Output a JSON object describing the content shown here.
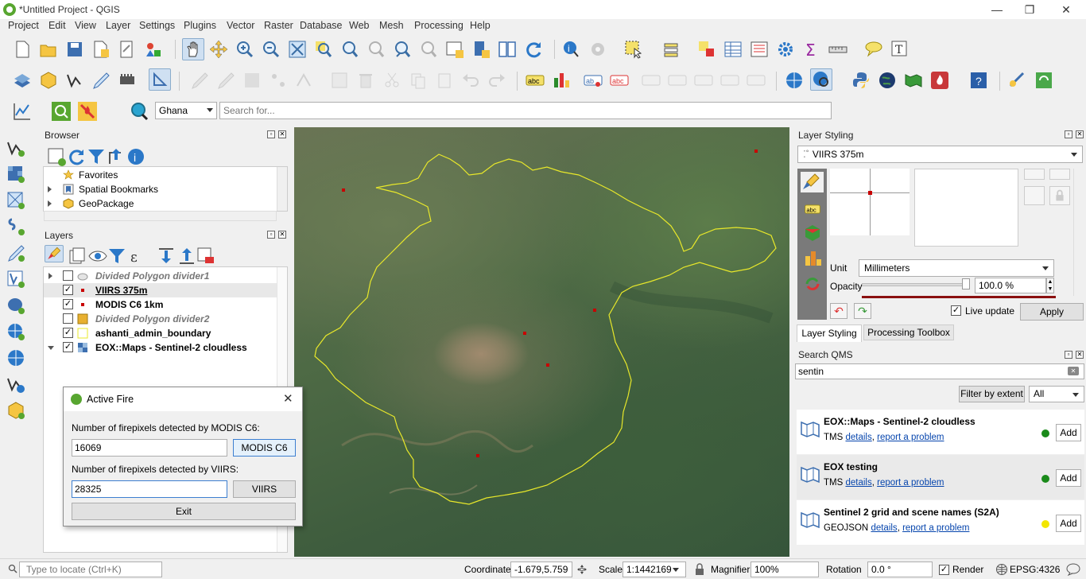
{
  "window": {
    "title": "*Untitled Project - QGIS",
    "minimize": "—",
    "restore": "❐",
    "close": "✕"
  },
  "menu": [
    "Project",
    "Edit",
    "View",
    "Layer",
    "Settings",
    "Plugins",
    "Vector",
    "Raster",
    "Database",
    "Web",
    "Mesh",
    "Processing",
    "Help"
  ],
  "locator_bar": {
    "country": "Ghana",
    "search_placeholder": "Search for..."
  },
  "browser": {
    "title": "Browser",
    "items": [
      {
        "label": "Favorites",
        "icon": "star-icon"
      },
      {
        "label": "Spatial Bookmarks",
        "icon": "bookmark-icon"
      },
      {
        "label": "GeoPackage",
        "icon": "geopackage-icon"
      }
    ]
  },
  "layers": {
    "title": "Layers",
    "items": [
      {
        "label": "Divided Polygon divider1",
        "checked": false,
        "italic": true,
        "expandable": true
      },
      {
        "label": "VIIRS 375m",
        "checked": true,
        "italic": false,
        "expandable": false
      },
      {
        "label": "MODIS C6 1km",
        "checked": true,
        "italic": false,
        "expandable": false
      },
      {
        "label": "Divided Polygon divider2",
        "checked": false,
        "italic": true,
        "expandable": false
      },
      {
        "label": "ashanti_admin_boundary",
        "checked": true,
        "italic": false,
        "expandable": false
      },
      {
        "label": "EOX::Maps - Sentinel-2 cloudless",
        "checked": true,
        "italic": false,
        "expandable": true
      }
    ]
  },
  "layer_styling": {
    "title": "Layer Styling",
    "selected_layer": "VIIRS 375m",
    "unit_label": "Unit",
    "unit_value": "Millimeters",
    "opacity_label": "Opacity",
    "opacity_value": "100.0 %",
    "live_update_label": "Live update",
    "apply_label": "Apply",
    "tabs": [
      "Layer Styling",
      "Processing Toolbox"
    ]
  },
  "qms": {
    "title": "Search QMS",
    "search_value": "sentin",
    "filter_button": "Filter by extent",
    "filter_select": "All",
    "results": [
      {
        "name": "EOX::Maps - Sentinel-2 cloudless",
        "type": "TMS",
        "details": "details",
        "report": "report a problem",
        "status_color": "#1a8a1a",
        "add": "Add"
      },
      {
        "name": "EOX testing",
        "type": "TMS",
        "details": "details",
        "report": "report a problem",
        "status_color": "#1a8a1a",
        "add": "Add"
      },
      {
        "name": "Sentinel 2 grid and scene names (S2A)",
        "type": "GEOJSON",
        "details": "details",
        "report": "report a problem",
        "status_color": "#f2e600",
        "add": "Add"
      }
    ]
  },
  "dialog": {
    "title": "Active Fire",
    "modis_label": "Number of firepixels detected by MODIS C6:",
    "modis_value": "16069",
    "modis_button": "MODIS C6",
    "viirs_label": "Number of firepixels detected by VIIRS:",
    "viirs_value": "28325",
    "viirs_button": "VIIRS",
    "exit_button": "Exit"
  },
  "statusbar": {
    "locate_placeholder": "Type to locate (Ctrl+K)",
    "coordinate_label": "Coordinate",
    "coordinate_value": "-1.679,5.759",
    "scale_label": "Scale",
    "scale_value": "1:1442169",
    "magnifier_label": "Magnifier",
    "magnifier_value": "100%",
    "rotation_label": "Rotation",
    "rotation_value": "0.0 °",
    "render_label": "Render",
    "crs": "EPSG:4326"
  },
  "colors": {
    "qgis_green": "#58a630",
    "boundary_yellow": "#e8e82a",
    "fire_red": "#c80000"
  }
}
